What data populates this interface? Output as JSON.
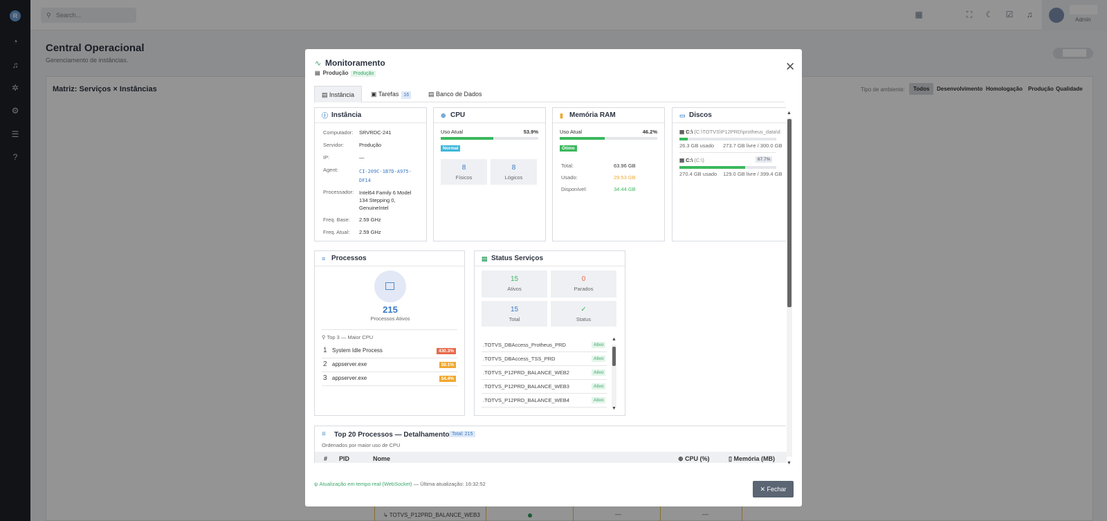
{
  "app": {
    "sidebar_logo": "R",
    "sidebar_icons": [
      "dashboard-icon",
      "bell-icon",
      "settings-gear-icon",
      "gear-icon",
      "server-icon",
      "help-icon"
    ]
  },
  "topbar": {
    "search_placeholder": "Search...",
    "user_role": "Admin"
  },
  "page": {
    "title": "Central Operacional",
    "subtitle": "Gerenciamento de instâncias."
  },
  "matrix": {
    "title": "Matriz: Serviços × Instâncias",
    "env_label": "Tipo de ambiente:",
    "env_filters": [
      "Todos",
      "Desenvolvimento",
      "Homologação",
      "Produção",
      "Qualidade"
    ],
    "env_selected": "Todos",
    "row_label": "↳ TOTVS_P12PRD_BALANCE_WEB3",
    "row_cells": [
      "—",
      "—"
    ]
  },
  "modal": {
    "title": "Monitoramento",
    "env": "Produção",
    "env_badge": "Produção",
    "tabs": [
      {
        "label": "Instância",
        "count": ""
      },
      {
        "label": "Tarefas",
        "count": "16"
      },
      {
        "label": "Banco de Dados",
        "count": ""
      }
    ],
    "instancia": {
      "title": "Instância",
      "rows": [
        {
          "k": "Computador:",
          "v": "SRVRDC-241"
        },
        {
          "k": "Servidor:",
          "v": "Produção"
        },
        {
          "k": "IP:",
          "v": "—"
        },
        {
          "k": "Agent:",
          "v": "CI-209C-1B7D-A975-DF14"
        },
        {
          "k": "Processador:",
          "v": "Intel64 Family 6 Model 134 Stepping 0, GenuineIntel"
        },
        {
          "k": "Freq. Base:",
          "v": "2.59 GHz"
        },
        {
          "k": "Freq. Atual:",
          "v": "2.59 GHz"
        }
      ]
    },
    "cpu": {
      "title": "CPU",
      "usage_label": "Uso Atual",
      "usage": "53.9%",
      "usage_pct": 53.9,
      "status": "Normal",
      "physical": "8",
      "physical_label": "Físicos",
      "logical": "8",
      "logical_label": "Lógicos"
    },
    "ram": {
      "title": "Memória RAM",
      "usage_label": "Uso Atual",
      "usage": "46.2%",
      "usage_pct": 46.2,
      "status": "Ótimo",
      "total_label": "Total:",
      "total": "63.96 GB",
      "used_label": "Usado:",
      "used": "29.53 GB",
      "free_label": "Disponível:",
      "free": "34.44 GB"
    },
    "discos": {
      "title": "Discos",
      "items": [
        {
          "drive": "C:\\",
          "path": "(C:\\TOTVS\\P12PRD\\protheus_data\\d",
          "pct": "",
          "used": "26.3 GB usado",
          "free": "273.7 GB livre / 300.0 GB",
          "fill": 8.8
        },
        {
          "drive": "C:\\",
          "path": "(C:\\)",
          "pct": "67.7%",
          "used": "270.4 GB usado",
          "free": "129.0 GB livre / 399.4 GB",
          "fill": 67.7
        }
      ]
    },
    "processos": {
      "title": "Processos",
      "count": "215",
      "count_label": "Processos Ativos",
      "top_label": "Top 3 — Maior CPU",
      "top": [
        {
          "rank": "1",
          "name": "System Idle Process",
          "value": "430.3%",
          "color": "#e86a4a"
        },
        {
          "rank": "2",
          "name": "appserver.exe",
          "value": "59.1%",
          "color": "#f0a830"
        },
        {
          "rank": "3",
          "name": "appserver.exe",
          "value": "54.4%",
          "color": "#f0a830"
        }
      ]
    },
    "servicos": {
      "title": "Status Serviços",
      "ativos": "15",
      "ativos_label": "Ativos",
      "parados": "0",
      "parados_label": "Parados",
      "total": "15",
      "total_label": "Total",
      "status_label": "Status",
      "list": [
        {
          "name": ".TOTVS_DBAccess_Protheus_PRD",
          "status": "Ativo"
        },
        {
          "name": ".TOTVS_DBAccess_TSS_PRD",
          "status": "Ativo"
        },
        {
          "name": ".TOTVS_P12PRD_BALANCE_WEB2",
          "status": "Ativo"
        },
        {
          "name": ".TOTVS_P12PRD_BALANCE_WEB3",
          "status": "Ativo"
        },
        {
          "name": ".TOTVS_P12PRD_BALANCE_WEB4",
          "status": "Ativo"
        }
      ]
    },
    "top20": {
      "title": "Top 20 Processos — Detalhamento",
      "total_badge": "Total: 215",
      "subtitle": "Ordenados por maior uso de CPU",
      "cols": [
        "#",
        "PID",
        "Nome",
        "CPU (%)",
        "Memória (MB)"
      ]
    },
    "footer": {
      "realtime": "Atualização em tempo real (WebSocket)",
      "last": "— Última atualização: 16:32:52",
      "close": "Fechar"
    }
  }
}
